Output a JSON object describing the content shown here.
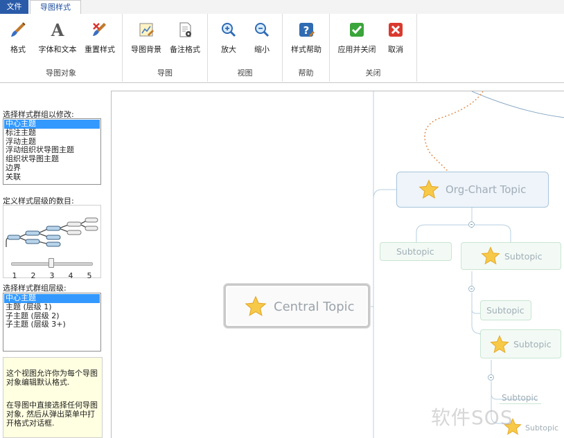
{
  "tabs": {
    "file": "文件",
    "map_style": "导图样式"
  },
  "ribbon": {
    "groups": {
      "map_object": "导图对象",
      "map": "导图",
      "view": "视图",
      "help": "帮助",
      "close": "关闭"
    },
    "buttons": {
      "format": "格式",
      "font_text": "字体和文本",
      "reset_style": "重置样式",
      "map_background": "导图背景",
      "note_format": "备注格式",
      "zoom_in": "放大",
      "zoom_out": "缩小",
      "style_help": "样式帮助",
      "apply_close": "应用并关闭",
      "cancel": "取消"
    }
  },
  "left_panel": {
    "group_label": "选择样式群组以修改:",
    "groups": [
      "中心主题",
      "标注主题",
      "浮动主题",
      "浮动组织状导图主题",
      "组织状导图主题",
      "边界",
      "关联"
    ],
    "levels_label": "定义样式层级的数目:",
    "slider_ticks": [
      "1",
      "2",
      "3",
      "4",
      "5"
    ],
    "slider_value": 3,
    "level_select_label": "选择样式群组层级:",
    "levels": [
      "中心主题",
      "主题 (层级 1)",
      "子主题 (层级 2)",
      "子主题 (层级 3+)"
    ],
    "info_1": "这个视图允许你为每个导图对象编辑默认格式.",
    "info_2": "在导图中直接选择任何导图对象, 然后从弹出菜单中打开格式对话框."
  },
  "canvas": {
    "central_topic": "Central Topic",
    "org_topic": "Org-Chart Topic",
    "subtopic_1": "Subtopic",
    "subtopic_2": "Subtopic",
    "subtopic_3": "Subtopic",
    "subtopic_4": "Subtopic",
    "subtopic_5": "Subtopic",
    "subtopic_6": "Subtopic"
  },
  "watermark": "软件SOS",
  "colors": {
    "file_tab": "#2a5ba8",
    "selection": "#3399ff",
    "info_bg": "#ffffe1",
    "relation_line": "#e0945a",
    "star": "#f7c948"
  }
}
